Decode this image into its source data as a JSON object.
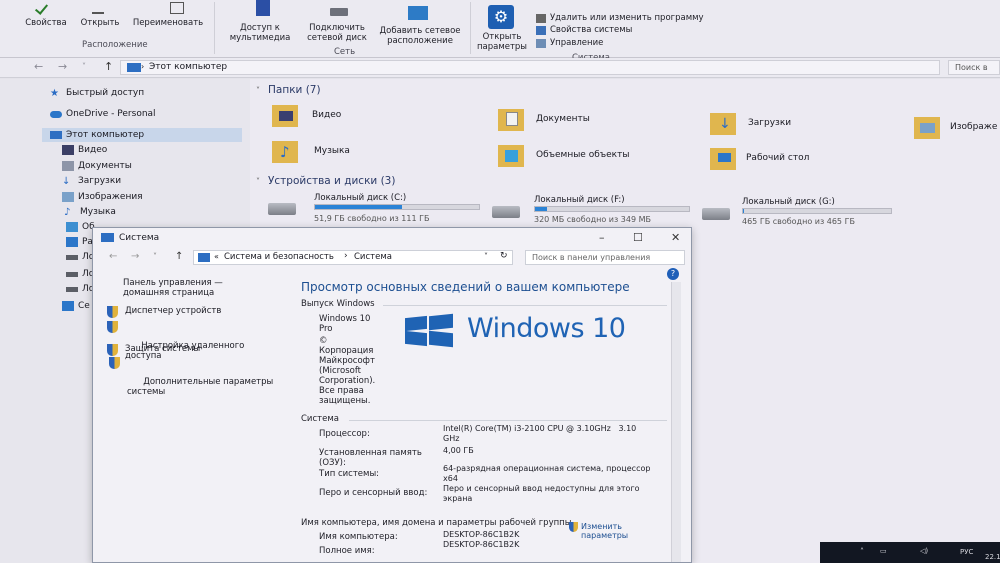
{
  "ribbon": {
    "properties": "Свойства",
    "open": "Открыть",
    "rename": "Переименовать",
    "location_group": "Расположение",
    "media_access": "Доступ к\nмультимедиа",
    "map_drive": "Подключить\nсетевой диск",
    "add_location": "Добавить сетевое\nрасположение",
    "network_group": "Сеть",
    "open_params": "Открыть\nпараметры",
    "uninstall": "Удалить или изменить программу",
    "system_props": "Свойства системы",
    "manage": "Управление",
    "system_group": "Система"
  },
  "address": {
    "path": "Этот компьютер",
    "search_placeholder": "Поиск в"
  },
  "nav": {
    "quick_access": "Быстрый доступ",
    "onedrive": "OneDrive - Personal",
    "this_pc": "Этот компьютер",
    "video": "Видео",
    "documents": "Документы",
    "downloads": "Загрузки",
    "images": "Изображения",
    "music": "Музыка",
    "obj": "Об",
    "desk": "Ра",
    "loc1": "Ло",
    "loc2": "Ло",
    "loc3": "Ло",
    "net": "Се"
  },
  "content": {
    "folders_title": "Папки (7)",
    "folders": [
      "Видео",
      "Документы",
      "Загрузки",
      "Изображе",
      "Музыка",
      "Объемные объекты",
      "Рабочий стол"
    ],
    "drives_title": "Устройства и диски (3)",
    "drives": [
      {
        "name": "Локальный диск (C:)",
        "free": "51,9 ГБ свободно из 111 ГБ",
        "used": 0.53
      },
      {
        "name": "Локальный диск (F:)",
        "free": "320 МБ свободно из 349 МБ",
        "used": 0.08
      },
      {
        "name": "Локальный диск (G:)",
        "free": "465 ГБ свободно из 465 ГБ",
        "used": 0.01
      }
    ]
  },
  "system_window": {
    "title": "Система",
    "breadcrumb_prefix": "«",
    "breadcrumb_1": "Система и безопасность",
    "breadcrumb_2": "Система",
    "search_placeholder": "Поиск в панели управления",
    "left_links": {
      "control_panel": "Панель управления —\nдомашняя страница",
      "device_manager": "Диспетчер устройств",
      "remote": "Настройка удаленного\nдоступа",
      "protection": "Защита системы",
      "advanced": "Дополнительные параметры\nсистемы"
    },
    "heading": "Просмотр основных сведений о вашем компьютере",
    "edition_section": "Выпуск Windows",
    "edition": "Windows 10\nPro",
    "copyright": "©\nКорпорация\nМайкрософт\n(Microsoft\nCorporation).\nВсе права\nзащищены.",
    "windows_logo_text": "Windows 10",
    "system_section": "Система",
    "processor_label": "Процессор:",
    "processor_value": "Intel(R) Core(TM) i3-2100 CPU @ 3.10GHz   3.10\nGHz",
    "ram_label": "Установленная память\n(ОЗУ):",
    "ram_value": "4,00 ГБ",
    "type_label": "Тип системы:",
    "type_value": "64-разрядная операционная система, процессор\nx64",
    "pen_label": "Перо и сенсорный ввод:",
    "pen_value": "Перо и сенсорный ввод недоступны для этого\nэкрана",
    "name_section": "Имя компьютера, имя домена и параметры рабочей группы",
    "computer_name_label": "Имя компьютера:",
    "computer_name_value": "DESKTOP-86C1B2K",
    "full_name_label": "Полное имя:",
    "full_name_value": "DESKTOP-86C1B2K",
    "change_link": "Изменить\nпараметры"
  },
  "tray": {
    "lang": "РУС",
    "date_fragment": "22.1"
  }
}
